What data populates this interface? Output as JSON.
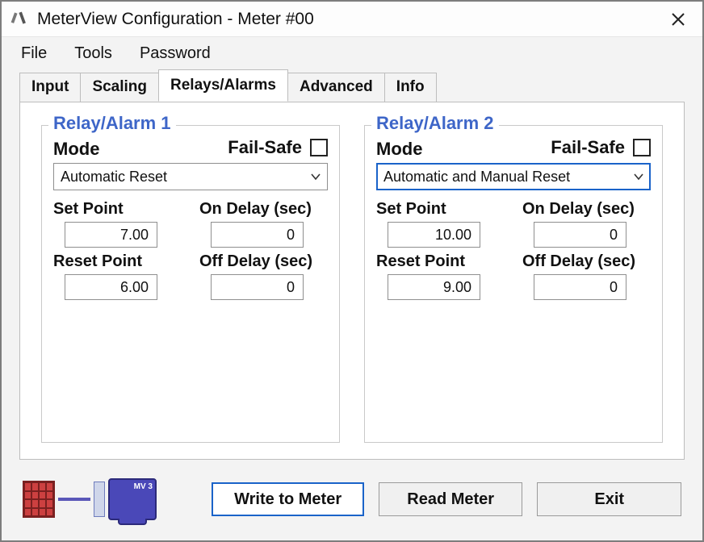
{
  "window": {
    "title": "MeterView Configuration - Meter #00"
  },
  "menu": {
    "file": "File",
    "tools": "Tools",
    "password": "Password"
  },
  "tabs": {
    "input": "Input",
    "scaling": "Scaling",
    "relays": "Relays/Alarms",
    "advanced": "Advanced",
    "info": "Info"
  },
  "labels": {
    "failsafe": "Fail-Safe",
    "mode": "Mode",
    "set_point": "Set Point",
    "on_delay": "On Delay (sec)",
    "reset_point": "Reset Point",
    "off_delay": "Off Delay (sec)"
  },
  "relay1": {
    "legend": "Relay/Alarm 1",
    "failsafe": false,
    "mode": "Automatic Reset",
    "set_point": "7.00",
    "on_delay": "0",
    "reset_point": "6.00",
    "off_delay": "0"
  },
  "relay2": {
    "legend": "Relay/Alarm 2",
    "failsafe": false,
    "mode": "Automatic and Manual Reset",
    "set_point": "10.00",
    "on_delay": "0",
    "reset_point": "9.00",
    "off_delay": "0"
  },
  "buttons": {
    "write": "Write to Meter",
    "read": "Read Meter",
    "exit": "Exit"
  },
  "monitor_badge": "MV 3"
}
